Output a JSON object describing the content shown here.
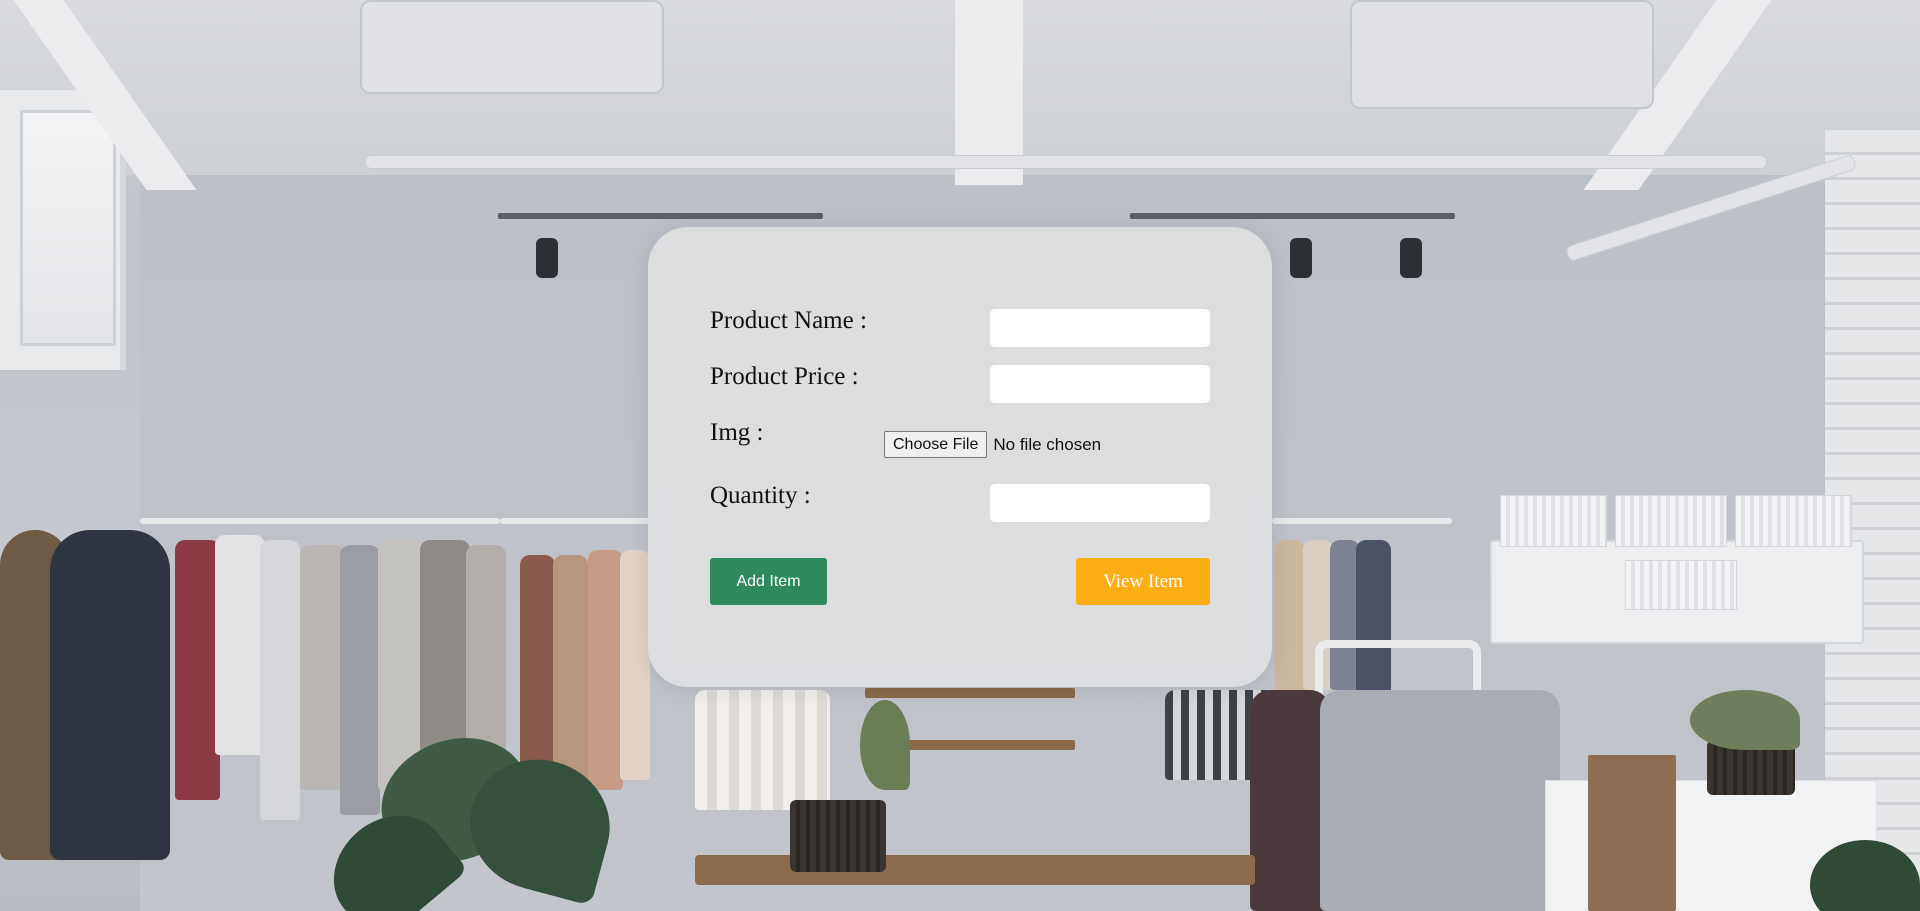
{
  "form": {
    "product_name_label": "Product Name :",
    "product_name_value": "",
    "product_price_label": "Product Price :",
    "product_price_value": "",
    "img_label": "Img :",
    "file_button_label": "Choose File",
    "file_status": "No file chosen",
    "quantity_label": "Quantity :",
    "quantity_value": ""
  },
  "actions": {
    "add_label": "Add Item",
    "view_label": "View Item"
  },
  "colors": {
    "add_button": "#2e8a5d",
    "view_button": "#fbad14",
    "card_background": "#e2e3e5"
  }
}
